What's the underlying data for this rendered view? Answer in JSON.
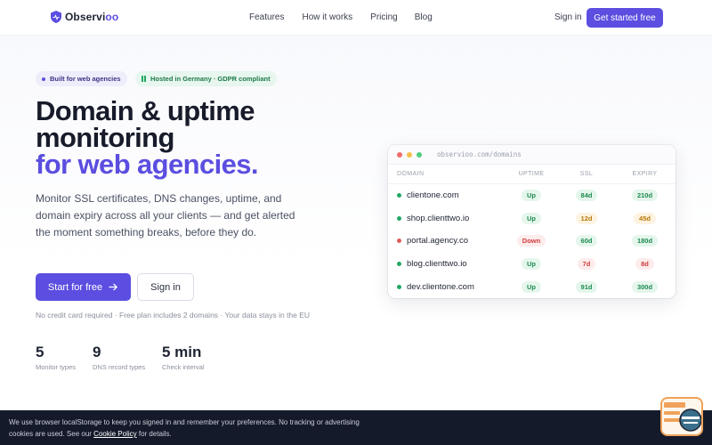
{
  "nav": {
    "logo_prefix": "Observi",
    "logo_accent": "oo",
    "links": [
      "Features",
      "How it works",
      "Pricing",
      "Blog"
    ],
    "signin": "Sign in",
    "cta": "Get started free"
  },
  "hero": {
    "badge_agency": "Built for web agencies",
    "badge_germany": "Hosted in Germany · GDPR compliant",
    "title_line1": "Domain & uptime",
    "title_line2": "monitoring",
    "title_accent": "for web agencies.",
    "lead": "Monitor SSL certificates, DNS changes, uptime, and domain expiry across all your clients — and get alerted the moment something breaks, before they do.",
    "primary_cta": "Start for free",
    "secondary_cta": "Sign in",
    "fineprint": "No credit card required · Free plan includes 2 domains · Your data stays in the EU"
  },
  "stats": [
    {
      "value": "5",
      "label": "Monitor types"
    },
    {
      "value": "9",
      "label": "DNS record types"
    },
    {
      "value": "5 min",
      "label": "Check interval"
    }
  ],
  "preview": {
    "url": "observioo.com/domains",
    "columns": [
      "DOMAIN",
      "UPTIME",
      "SSL",
      "EXPIRY"
    ],
    "rows": [
      {
        "domain": "clientone.com",
        "uptime": "Up",
        "ssl": "84d",
        "expiry": "210d"
      },
      {
        "domain": "shop.clienttwo.io",
        "uptime": "Up",
        "ssl": "12d",
        "expiry": "45d"
      },
      {
        "domain": "portal.agency.co",
        "uptime": "Down",
        "ssl": "60d",
        "expiry": "180d"
      },
      {
        "domain": "blog.clienttwo.io",
        "uptime": "Up",
        "ssl": "7d",
        "expiry": "8d"
      },
      {
        "domain": "dev.clientone.com",
        "uptime": "Up",
        "ssl": "91d",
        "expiry": "300d"
      }
    ]
  },
  "cookie": {
    "text_before": "We use browser localStorage to keep you signed in and remember your preferences. No tracking or advertising cookies are used. See our ",
    "link": "Cookie Policy",
    "text_after": " for details."
  },
  "colors": {
    "accent": "#5b4ee0",
    "status_green": "#22a863",
    "status_red": "#e05a5a",
    "status_amber": "#e7a23a"
  }
}
